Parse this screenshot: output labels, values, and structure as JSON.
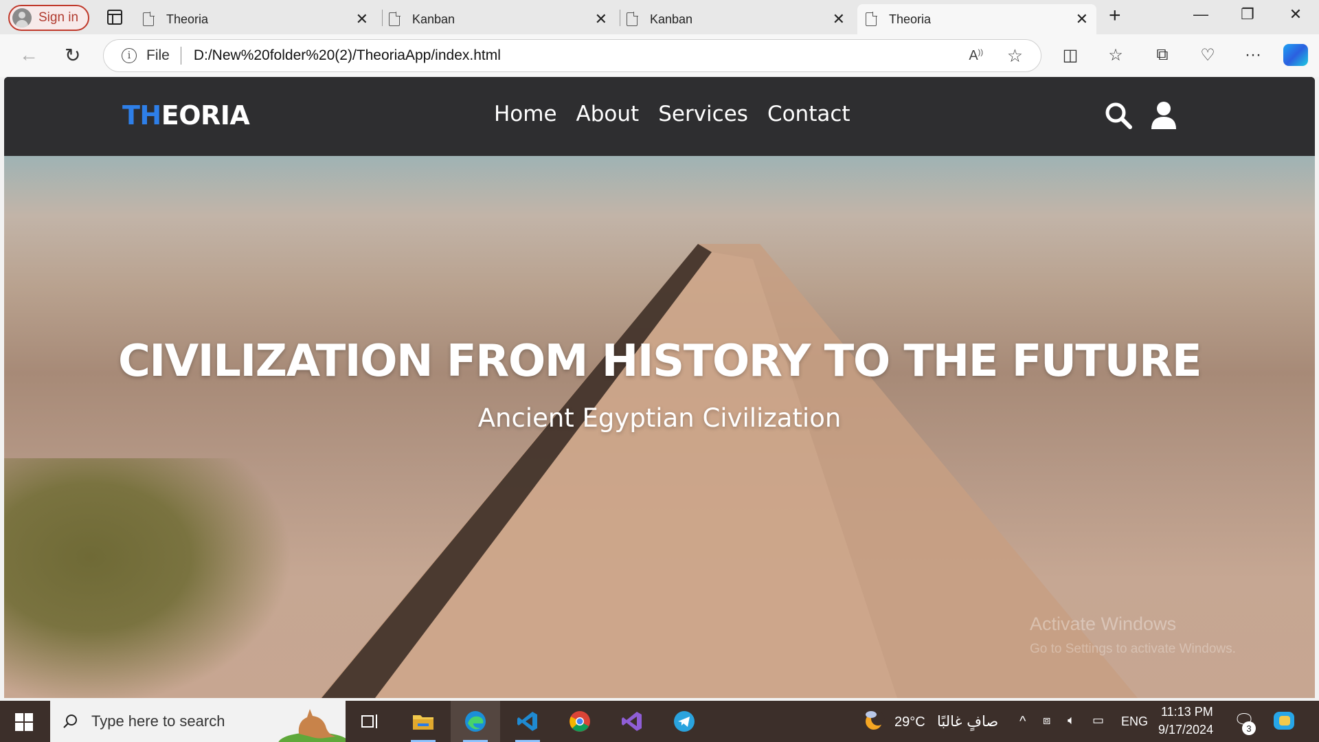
{
  "browser": {
    "signin_label": "Sign in",
    "tabs": [
      {
        "title": "Theoria"
      },
      {
        "title": "Kanban"
      },
      {
        "title": "Kanban"
      },
      {
        "title": "Theoria",
        "active": true
      }
    ],
    "address": {
      "scheme_label": "File",
      "url": "D:/New%20folder%20(2)/TheoriaApp/index.html"
    }
  },
  "site": {
    "logo": {
      "accent": "TH",
      "rest": "EORIA"
    },
    "nav": [
      "Home",
      "About",
      "Services",
      "Contact"
    ],
    "hero": {
      "title": "CIVILIZATION FROM HISTORY TO THE FUTURE",
      "subtitle": "Ancient Egyptian Civilization"
    },
    "watermark": {
      "line1": "Activate Windows",
      "line2": "Go to Settings to activate Windows."
    }
  },
  "taskbar": {
    "search_placeholder": "Type here to search",
    "weather": {
      "temp": "29°C",
      "desc": "صافٍ غالبًا"
    },
    "language": "ENG",
    "time": "11:13 PM",
    "date": "9/17/2024",
    "notifications": "3"
  },
  "colors": {
    "logo_accent": "#2e7fe8",
    "nav_bg": "#2e2e30",
    "taskbar_bg": "#3c2f2a",
    "signin_border": "#c0392b"
  }
}
